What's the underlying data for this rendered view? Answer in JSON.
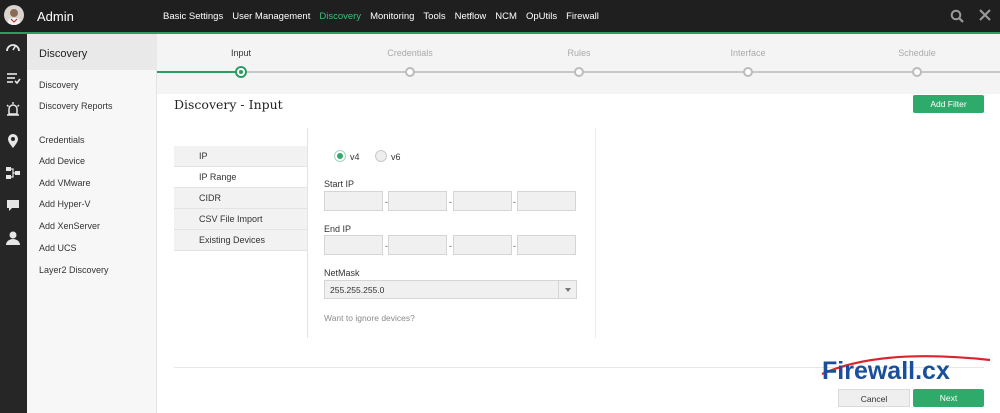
{
  "app": {
    "title": "Admin"
  },
  "topnav": [
    {
      "label": "Basic Settings",
      "active": false
    },
    {
      "label": "User Management",
      "active": false
    },
    {
      "label": "Discovery",
      "active": true
    },
    {
      "label": "Monitoring",
      "active": false
    },
    {
      "label": "Tools",
      "active": false
    },
    {
      "label": "Netflow",
      "active": false
    },
    {
      "label": "NCM",
      "active": false
    },
    {
      "label": "OpUtils",
      "active": false
    },
    {
      "label": "Firewall",
      "active": false
    }
  ],
  "rail_icons": [
    "dashboard-icon",
    "inventory-icon",
    "alarm-icon",
    "map-icon",
    "network-icon",
    "chat-icon",
    "user-icon"
  ],
  "sidebar": {
    "header": "Discovery",
    "items": [
      {
        "label": "Discovery"
      },
      {
        "label": "Discovery Reports"
      },
      {
        "label": "Credentials"
      },
      {
        "label": "Add Device"
      },
      {
        "label": "Add VMware"
      },
      {
        "label": "Add Hyper-V"
      },
      {
        "label": "Add XenServer"
      },
      {
        "label": "Add UCS"
      },
      {
        "label": "Layer2 Discovery"
      }
    ]
  },
  "wizard": {
    "steps": [
      {
        "label": "Input",
        "active": true
      },
      {
        "label": "Credentials",
        "active": false
      },
      {
        "label": "Rules",
        "active": false
      },
      {
        "label": "Interface",
        "active": false
      },
      {
        "label": "Schedule",
        "active": false
      }
    ]
  },
  "main": {
    "title": "Discovery - Input",
    "add_filter_label": "Add Filter",
    "tabs": [
      {
        "label": "IP",
        "active": false
      },
      {
        "label": "IP Range",
        "active": true
      },
      {
        "label": "CIDR",
        "active": false
      },
      {
        "label": "CSV File Import",
        "active": false
      },
      {
        "label": "Existing Devices",
        "active": false
      }
    ],
    "ip_version": {
      "v4": "v4",
      "v6": "v6",
      "selected": "v4"
    },
    "start_ip_label": "Start IP",
    "start_ip": [
      "",
      "",
      "",
      ""
    ],
    "end_ip_label": "End IP",
    "end_ip": [
      "",
      "",
      "",
      ""
    ],
    "netmask_label": "NetMask",
    "netmask_value": "255.255.255.0",
    "ignore_link": "Want to ignore devices?",
    "cancel_label": "Cancel",
    "next_label": "Next"
  },
  "watermark": {
    "text": "Firewall.cx"
  },
  "colors": {
    "accent": "#2eaa6a",
    "topbar": "#1f1f1f",
    "active_nav": "#34c07d"
  }
}
